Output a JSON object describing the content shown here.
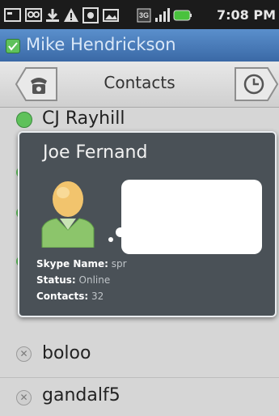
{
  "status_bar": {
    "time": "7:08 PM",
    "icons": [
      "notification-icon",
      "voicemail-icon",
      "download-icon",
      "warning-icon",
      "settings-icon",
      "image-icon",
      "3g-data-icon",
      "signal-icon",
      "battery-icon"
    ]
  },
  "user_bar": {
    "name": "Mike Hendrickson",
    "status": "online"
  },
  "header": {
    "title": "Contacts",
    "left_icon": "phone-icon",
    "right_icon": "clock-icon"
  },
  "contacts": [
    {
      "name": "CJ Rayhill",
      "status": "online"
    },
    {
      "name": "boloo",
      "status": "offline"
    },
    {
      "name": "gandalf5",
      "status": "offline"
    }
  ],
  "popup": {
    "name": "Joe Fernand",
    "skype_label": "Skype Name:",
    "skype_value": "spr",
    "status_label": "Status:",
    "status_value": "Online",
    "contacts_label": "Contacts:",
    "contacts_value": "32"
  },
  "colors": {
    "user_bar": "#3a69a6",
    "online": "#5fc15b",
    "popup_bg": "#4a5157"
  }
}
